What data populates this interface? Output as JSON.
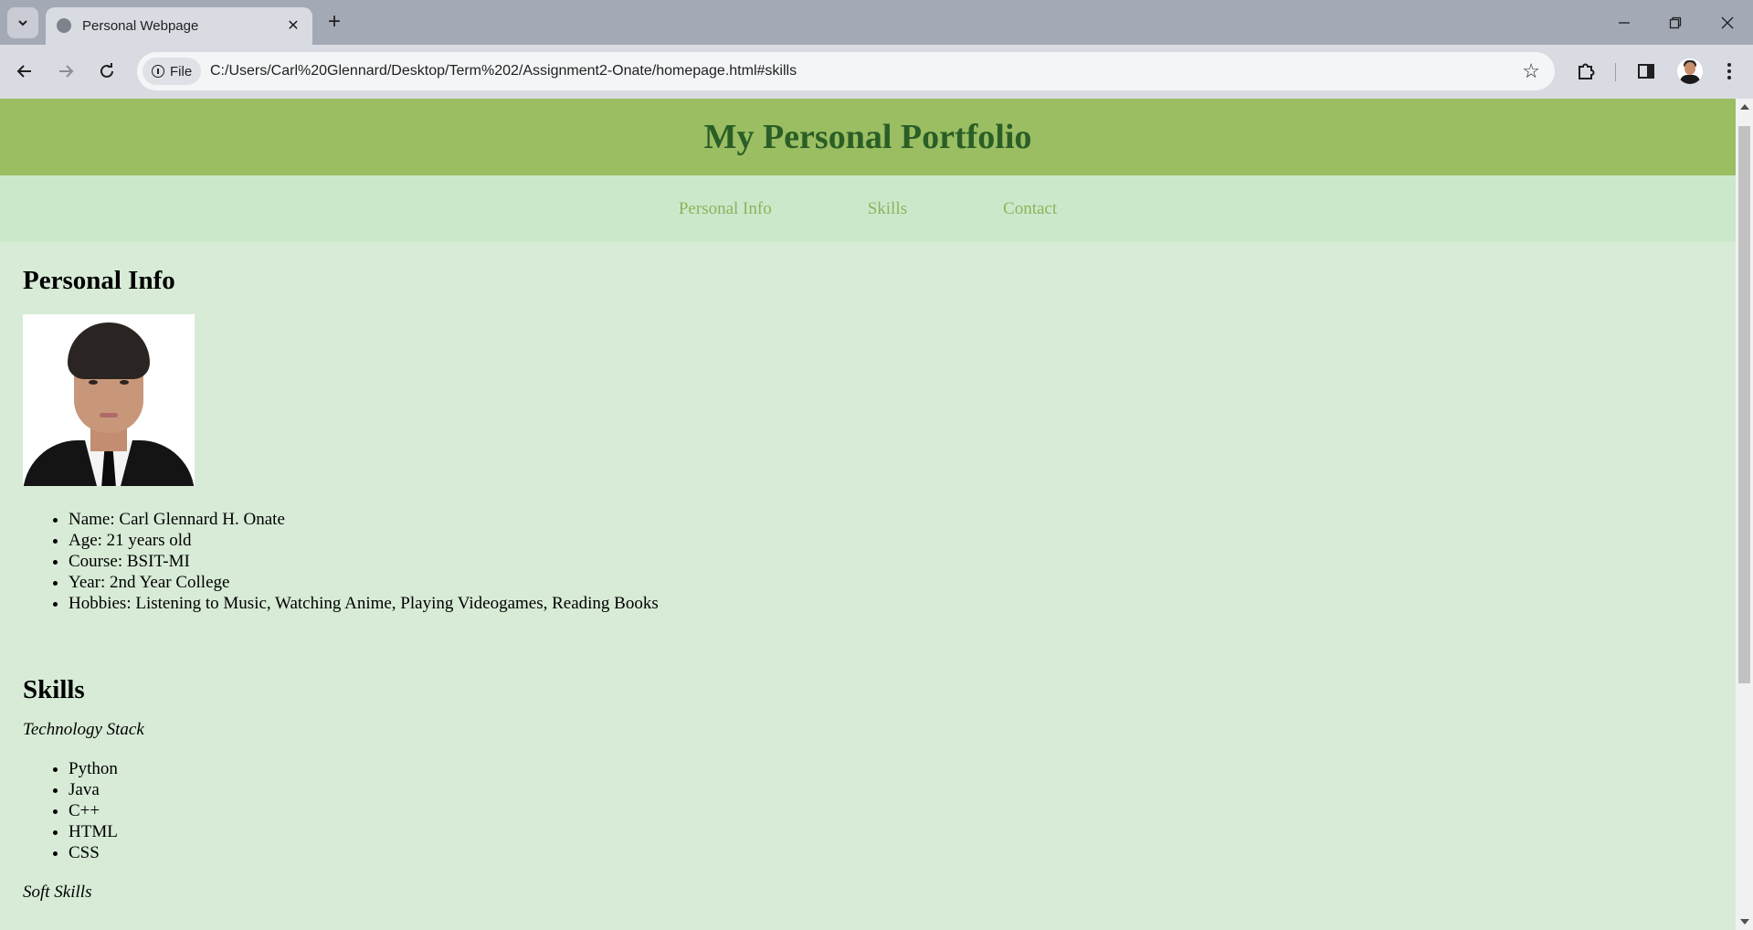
{
  "browser": {
    "tab_title": "Personal Webpage",
    "address_chip": "File",
    "url": "C:/Users/Carl%20Glennard/Desktop/Term%202/Assignment2-Onate/homepage.html#skills"
  },
  "site": {
    "heading": "My Personal Portfolio",
    "nav": [
      "Personal Info",
      "Skills",
      "Contact"
    ]
  },
  "personal": {
    "title": "Personal Info",
    "items": [
      "Name: Carl Glennard H. Onate",
      "Age: 21 years old",
      "Course: BSIT-MI",
      "Year: 2nd Year College",
      "Hobbies: Listening to Music, Watching Anime, Playing Videogames, Reading Books"
    ]
  },
  "skills": {
    "title": "Skills",
    "tech_label": "Technology Stack",
    "tech": [
      "Python",
      "Java",
      "C++",
      "HTML",
      "CSS"
    ],
    "soft_label": "Soft Skills"
  },
  "colors": {
    "header_bg": "#9bbe62",
    "header_text": "#2a5e27",
    "nav_bg": "#cce8cb",
    "nav_link": "#8cb45a",
    "page_bg": "#d7ebd6"
  }
}
